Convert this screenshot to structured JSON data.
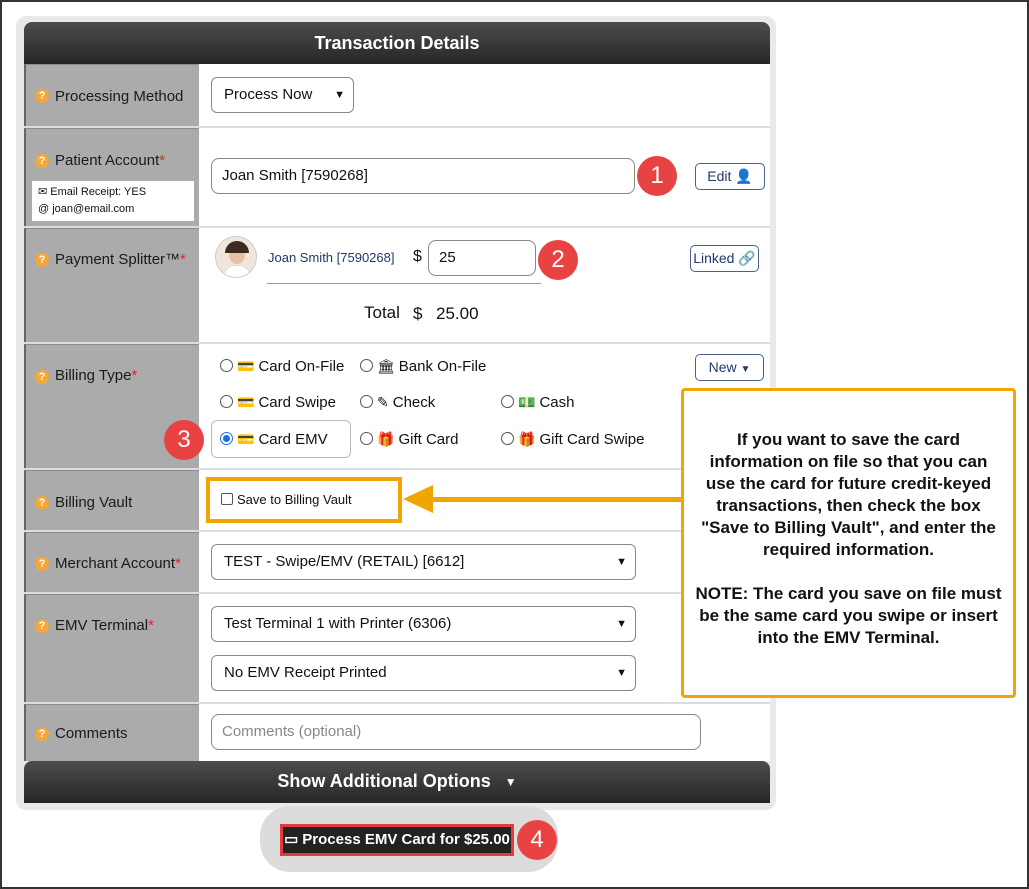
{
  "header": {
    "title": "Transaction Details"
  },
  "rows": {
    "processing_method": {
      "label": "Processing Method",
      "value": "Process Now"
    },
    "patient_account": {
      "label": "Patient Account",
      "required": "*",
      "email_receipt": "Email Receipt: YES",
      "email": "joan@email.com",
      "value": "Joan Smith [7590268]",
      "edit_label": "Edit",
      "step": "1"
    },
    "payment_splitter": {
      "label": "Payment Splitter™",
      "required": "*",
      "patient_name": "Joan Smith [7590268]",
      "currency": "$",
      "amount": "25",
      "linked_label": "Linked",
      "total_label": "Total",
      "total_currency": "$",
      "total_value": "25.00",
      "step": "2"
    },
    "billing_type": {
      "label": "Billing Type",
      "required": "*",
      "new_label": "New",
      "step": "3",
      "options": [
        {
          "label": "Card On-File",
          "icon": "credit-card-icon",
          "selected": false
        },
        {
          "label": "Bank On-File",
          "icon": "bank-icon",
          "selected": false
        },
        {
          "label": "Card Swipe",
          "icon": "credit-card-icon",
          "selected": false
        },
        {
          "label": "Check",
          "icon": "pencil-icon",
          "selected": false
        },
        {
          "label": "Cash",
          "icon": "cash-icon",
          "selected": false
        },
        {
          "label": "Card EMV",
          "icon": "credit-card-icon",
          "selected": true
        },
        {
          "label": "Gift Card",
          "icon": "gift-icon",
          "selected": false
        },
        {
          "label": "Gift Card Swipe",
          "icon": "gift-icon",
          "selected": false
        }
      ]
    },
    "billing_vault": {
      "label": "Billing Vault",
      "checkbox_label": "Save to Billing Vault",
      "checked": false
    },
    "merchant_account": {
      "label": "Merchant Account",
      "required": "*",
      "value": "TEST - Swipe/EMV (RETAIL) [6612]"
    },
    "emv_terminal": {
      "label": "EMV Terminal",
      "required": "*",
      "terminal": "Test Terminal 1 with Printer (6306)",
      "receipt": "No EMV Receipt Printed"
    },
    "comments": {
      "label": "Comments",
      "placeholder": "Comments (optional)"
    }
  },
  "footer": {
    "show_more_label": "Show Additional Options"
  },
  "process": {
    "label": "Process EMV Card for $25.00",
    "step": "4"
  },
  "callout": {
    "paragraph1": "If you want to save the card information on file so that you can use the card for future credit-keyed transactions, then check the box \"Save to Billing Vault\", and enter the required information.",
    "paragraph2": "NOTE: The card you save on file must be the same card you swipe or insert into the EMV Terminal."
  },
  "colors": {
    "accent_orange": "#f0a500",
    "badge_red": "#e84242",
    "header_dark": "#333333",
    "label_gray": "#ababab"
  }
}
